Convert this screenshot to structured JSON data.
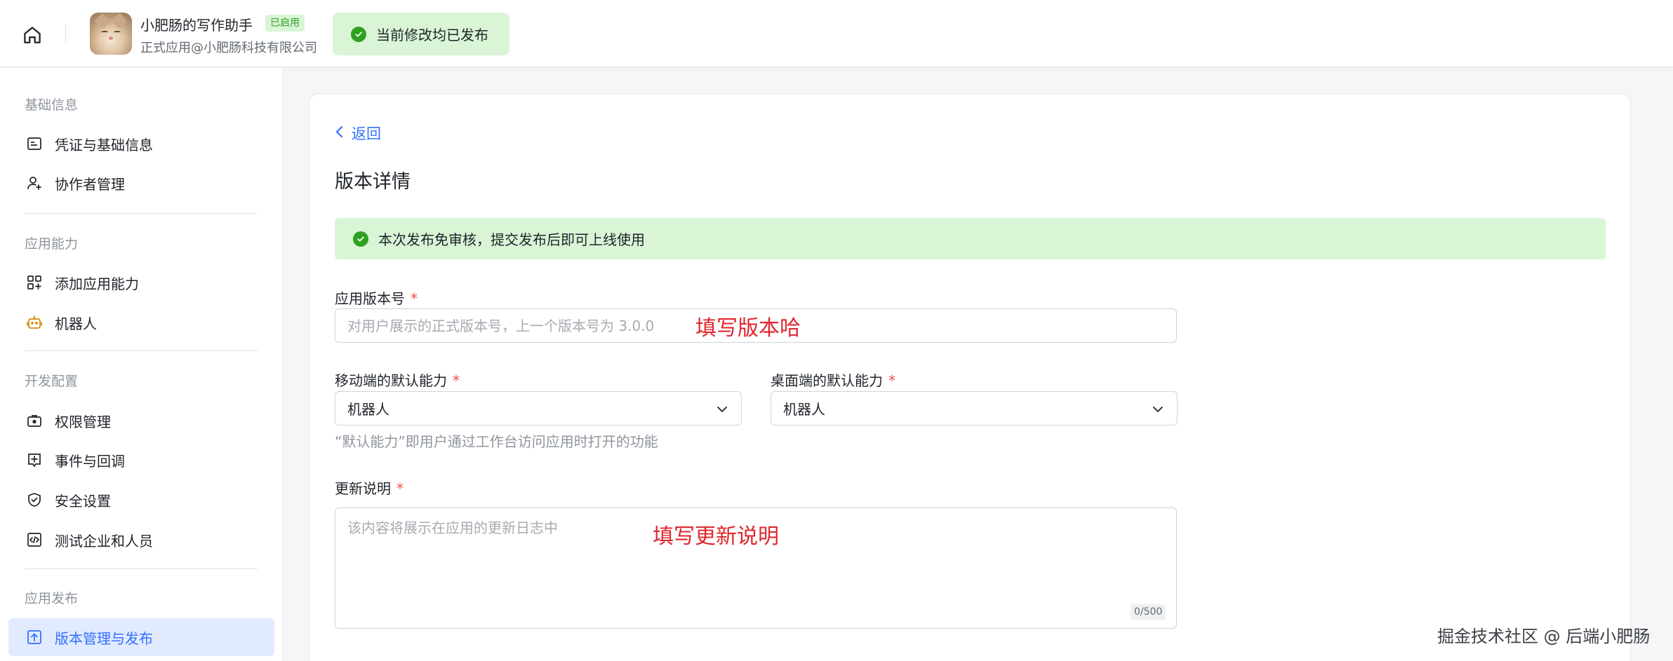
{
  "header": {
    "app_name": "小肥肠的写作助手",
    "app_badge": "已启用",
    "app_subtitle": "正式应用@小肥肠科技有限公司",
    "publish_status": "当前修改均已发布"
  },
  "sidebar": {
    "groups": [
      {
        "title": "基础信息",
        "items": [
          {
            "label": "凭证与基础信息",
            "icon": "id-card-icon"
          },
          {
            "label": "协作者管理",
            "icon": "user-add-icon"
          }
        ]
      },
      {
        "title": "应用能力",
        "items": [
          {
            "label": "添加应用能力",
            "icon": "apps-add-icon"
          },
          {
            "label": "机器人",
            "icon": "robot-icon"
          }
        ]
      },
      {
        "title": "开发配置",
        "items": [
          {
            "label": "权限管理",
            "icon": "briefcase-lock-icon"
          },
          {
            "label": "事件与回调",
            "icon": "event-plus-icon"
          },
          {
            "label": "安全设置",
            "icon": "shield-check-icon"
          },
          {
            "label": "测试企业和人员",
            "icon": "code-box-icon"
          }
        ]
      },
      {
        "title": "应用发布",
        "items": [
          {
            "label": "版本管理与发布",
            "icon": "upload-box-icon",
            "active": true
          }
        ]
      }
    ]
  },
  "main": {
    "back_label": "返回",
    "page_title": "版本详情",
    "notice": "本次发布免审核，提交发布后即可上线使用",
    "version_field": {
      "label": "应用版本号",
      "required_mark": "*",
      "placeholder": "对用户展示的正式版本号，上一个版本号为 3.0.0",
      "annotation": "填写版本哈"
    },
    "mobile_default": {
      "label": "移动端的默认能力",
      "required_mark": "*",
      "value": "机器人"
    },
    "desktop_default": {
      "label": "桌面端的默认能力",
      "required_mark": "*",
      "value": "机器人"
    },
    "default_hint": "“默认能力”即用户通过工作台访问应用时打开的功能",
    "update_notes": {
      "label": "更新说明",
      "required_mark": "*",
      "placeholder": "该内容将展示在应用的更新日志中",
      "annotation": "填写更新说明",
      "counter": "0/500"
    }
  },
  "watermark": "掘金技术社区 @ 后端小肥肠",
  "colors": {
    "accent": "#3370ff",
    "success": "#2ea121",
    "success_bg": "#d9f5d6",
    "required": "#f54a45",
    "annotation": "#e0262d"
  }
}
